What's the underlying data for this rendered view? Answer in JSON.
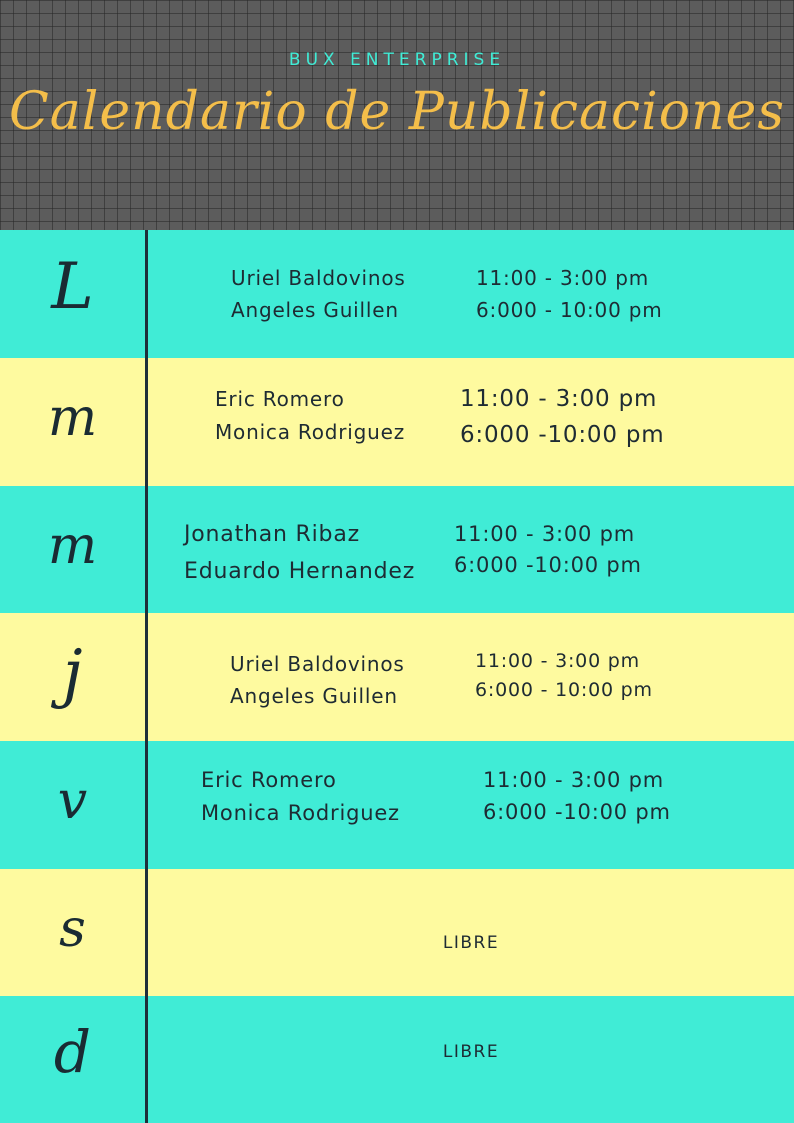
{
  "header": {
    "brand": "BUX ENTERPRISE",
    "title": "Calendario de Publicaciones",
    "brand_color": "#40ecd6",
    "title_color": "#f4be4a",
    "background_color": "#5c5c5c"
  },
  "colors": {
    "teal": "#40ecd6",
    "yellow": "#fefa9f",
    "divider": "#1e2f3a",
    "text": "#1e2b33"
  },
  "rows": [
    {
      "day": "L",
      "names": [
        "Uriel Baldovinos",
        "Angeles Guillen"
      ],
      "times": [
        "11:00 - 3:00  pm",
        "6:000 - 10:00 pm"
      ]
    },
    {
      "day": "m",
      "names": [
        "Eric Romero",
        "Monica Rodriguez"
      ],
      "times": [
        "11:00 - 3:00 pm",
        "6:000 -10:00 pm"
      ]
    },
    {
      "day": "m",
      "names": [
        "Jonathan Ribaz",
        "Eduardo Hernandez"
      ],
      "times": [
        "11:00 - 3:00 pm",
        "6:000 -10:00 pm"
      ]
    },
    {
      "day": "j",
      "names": [
        "Uriel Baldovinos",
        "Angeles Guillen"
      ],
      "times": [
        "11:00 - 3:00  pm",
        "6:000 - 10:00 pm"
      ]
    },
    {
      "day": "v",
      "names": [
        "Eric Romero",
        "Monica Rodriguez"
      ],
      "times": [
        "11:00 - 3:00 pm",
        "6:000 -10:00 pm"
      ]
    },
    {
      "day": "s",
      "libre": "LIBRE"
    },
    {
      "day": "d",
      "libre": "LIBRE"
    }
  ]
}
